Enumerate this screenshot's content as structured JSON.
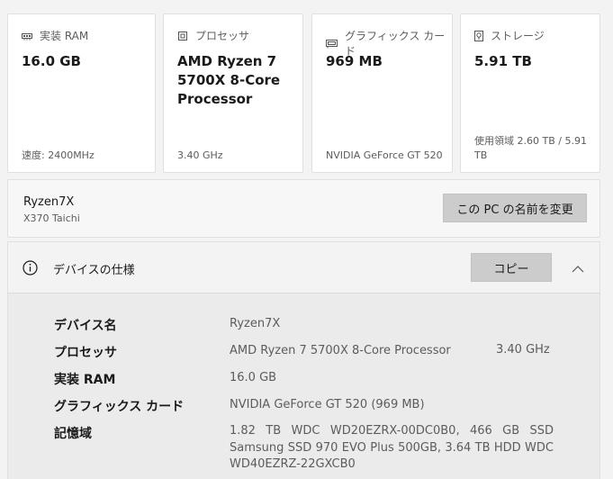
{
  "cards": [
    {
      "title": "実装 RAM",
      "icon": "ram-icon",
      "value": "16.0 GB",
      "footer": "速度: 2400MHz"
    },
    {
      "title": "プロセッサ",
      "icon": "processor-icon",
      "value": "AMD Ryzen 7 5700X 8-Core Processor",
      "footer": "3.40 GHz"
    },
    {
      "title": "グラフィックス カード",
      "icon": "graphics-card-icon",
      "value": "969 MB",
      "footer": "NVIDIA GeForce GT 520"
    },
    {
      "title": "ストレージ",
      "icon": "storage-icon",
      "value": "5.91 TB",
      "footer": "使用領域 2.60 TB / 5.91 TB"
    }
  ],
  "pc": {
    "name": "Ryzen7X",
    "model": "X370 Taichi",
    "rename_label": "この PC の名前を変更"
  },
  "spec": {
    "title": "デバイスの仕様",
    "copy_label": "コピー",
    "rows": [
      {
        "label": "デバイス名",
        "value": "Ryzen7X",
        "extra": ""
      },
      {
        "label": "プロセッサ",
        "value": "AMD Ryzen 7 5700X 8-Core Processor",
        "extra": "3.40 GHz"
      },
      {
        "label": "実装 RAM",
        "value": "16.0 GB",
        "extra": ""
      },
      {
        "label": "グラフィックス カード",
        "value": "NVIDIA GeForce GT 520 (969 MB)",
        "extra": ""
      },
      {
        "label": "記憶域",
        "value": "1.82 TB WDC WD20EZRX-00DC0B0, 466 GB SSD Samsung SSD 970 EVO Plus 500GB, 3.64 TB HDD WDC WD40EZRZ-22GXCB0",
        "extra": ""
      }
    ]
  }
}
